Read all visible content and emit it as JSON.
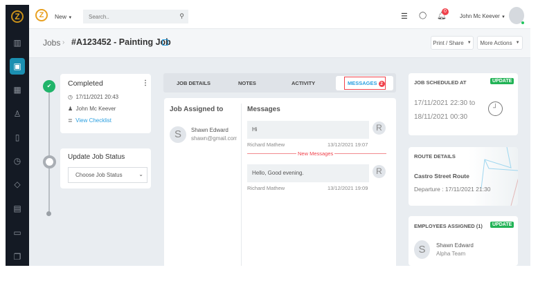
{
  "sidebar": {
    "icons": [
      "logo-icon",
      "chart-icon",
      "briefcase-icon",
      "calendar-icon",
      "user-icon",
      "map-icon",
      "clock-icon",
      "tag-icon",
      "calculator-icon",
      "folder-icon",
      "documents-icon"
    ]
  },
  "topbar": {
    "new_label": "New",
    "search_placeholder": "Search..",
    "notification_count": "0",
    "user_name": "John Mc Keever"
  },
  "breadcrumb": {
    "parent": "Jobs",
    "separator": "›",
    "title": "#A123452 - Painting Job"
  },
  "actions": {
    "print_share": "Print / Share",
    "more_actions": "More Actions"
  },
  "status_card": {
    "status": "Completed",
    "datetime": "17/11/2021 20:43",
    "user": "John Mc Keever",
    "checklist_link": "View Checklist"
  },
  "update_card": {
    "title": "Update Job Status",
    "select_value": "Choose Job Status"
  },
  "tabs": [
    {
      "label": "JOB DETAILS"
    },
    {
      "label": "NOTES"
    },
    {
      "label": "ACTIVITY"
    },
    {
      "label": "MESSAGES",
      "badge": "2"
    }
  ],
  "assigned": {
    "title": "Job Assigned to",
    "initial": "S",
    "name": "Shawn Edward",
    "email": "shawn@gmail.com"
  },
  "messages": {
    "title": "Messages",
    "divider": "New Messages",
    "items": [
      {
        "text": "Hi",
        "sender": "Richard Mathew",
        "time": "13/12/2021 19:07",
        "initial": "R"
      },
      {
        "text": "Hello, Good evening.",
        "sender": "Richard Mathew",
        "time": "13/12/2021 19:09",
        "initial": "R"
      }
    ]
  },
  "schedule": {
    "title": "JOB SCHEDULED AT",
    "update": "UPDATE",
    "from": "17/11/2021 22:30 to",
    "to": "18/11/2021 00:30"
  },
  "route": {
    "title": "ROUTE DETAILS",
    "name": "Castro Street Route",
    "departure": "Departure : 17/11/2021 21:30"
  },
  "employees": {
    "title": "EMPLOYEES ASSIGNED (1)",
    "update": "UPDATE",
    "initial": "S",
    "name": "Shawn Edward",
    "team": "Alpha Team"
  },
  "colors": {
    "accent": "#1b8fb1",
    "green": "#22b356",
    "red": "#f0414b",
    "link": "#2a9fe0"
  }
}
